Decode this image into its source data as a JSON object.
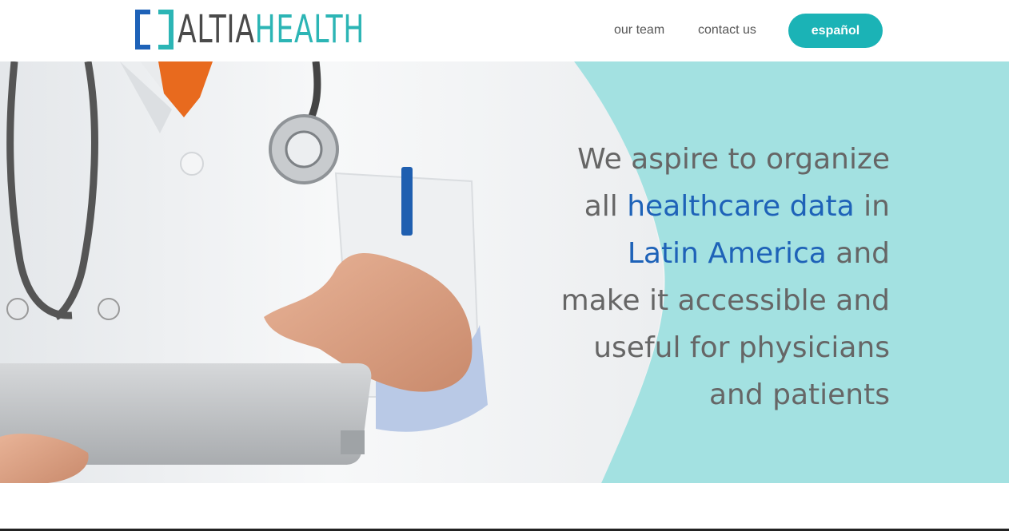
{
  "brand": {
    "logo_part1": "ALTIA",
    "logo_part2": "HEALTH",
    "colors": {
      "accent": "#2cb5b5",
      "dark": "#4a4a4a",
      "mark_blue": "#1e62b8"
    }
  },
  "nav": {
    "items": [
      {
        "label": "our team"
      },
      {
        "label": "contact us"
      }
    ],
    "language_button": "español"
  },
  "hero": {
    "tagline": {
      "l1": "We aspire to organize",
      "l2a": "all ",
      "l2b": "healthcare data",
      "l2c": " in",
      "l3a": "Latin America",
      "l3b": " and",
      "l4": "make it accessible and",
      "l5": "useful for physicians",
      "l6": "and patients"
    },
    "colors": {
      "panel": "#a3e1e1",
      "text": "#666666",
      "highlight": "#1e62b8"
    }
  }
}
